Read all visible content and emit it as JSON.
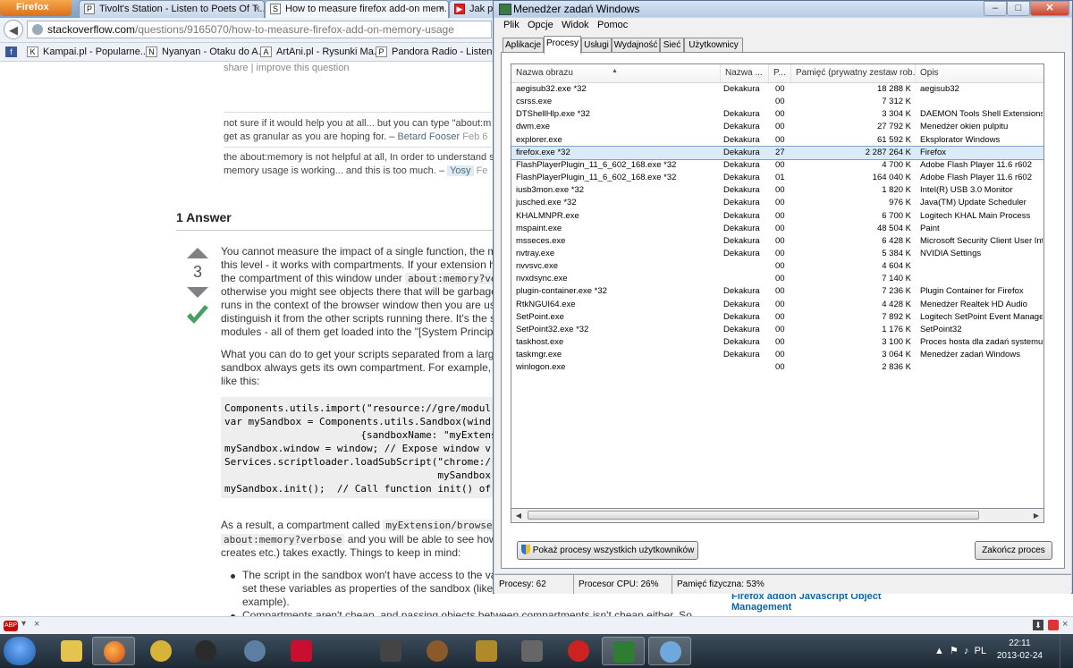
{
  "firefox": {
    "button_label": "Firefox",
    "tabs": [
      {
        "label": "Tivolt's Station - Listen to Poets Of T...",
        "favicon": "P"
      },
      {
        "label": "How to measure firefox add-on mem...",
        "favicon": "S"
      },
      {
        "label": "Jak po",
        "favicon": "▶"
      }
    ],
    "url_host": "stackoverflow.com",
    "url_path": "/questions/9165070/how-to-measure-firefox-add-on-memory-usage",
    "bookmarks": [
      {
        "label": "Kampai.pl - Popularne...",
        "icon": "K"
      },
      {
        "label": "Nyanyan - Otaku do A...",
        "icon": "N"
      },
      {
        "label": "ArtAni.pl - Rysunki Ma...",
        "icon": "A"
      },
      {
        "label": "Pandora Radio - Listen...",
        "icon": "P"
      }
    ],
    "addonbar_icon": "ABP"
  },
  "stackoverflow": {
    "question_links": {
      "share": "share",
      "sep": "|",
      "improve": "improve this question"
    },
    "comment1": {
      "line1": "not sure if it would help you at all... but you can type \"about:m",
      "line2": "get as granular as you are hoping for. – ",
      "user": "Betard Fooser",
      "date": "Feb 6"
    },
    "comment2": {
      "line1": "the about:memory is not helpful at all, In order to understand s",
      "line2": "memory usage is working... and this is too much. – ",
      "user": "Yosy",
      "date": "Fe"
    },
    "answer_header": "1 Answer",
    "vote_count": "3",
    "answer_lines": [
      "You cannot measure the impact of a single function, the m",
      "this level - it works with compartments. If your extension ha",
      "otherwise you might see objects there that will be garbage",
      "runs in the context of the browser window then you are usu",
      "distinguish it from the other scripts running there. It's the s",
      "modules - all of them get loaded into the \"[System Principa"
    ],
    "answer_line3_pre": "the compartment of this window under ",
    "answer_line3_code": "about:memory?ve",
    "para2_lines": [
      "What you can do to get your scripts separated from a larg",
      "sandbox always gets its own compartment. For example, in",
      "like this:"
    ],
    "code_lines": [
      "Components.utils.import(\"resource://gre/modul",
      "var mySandbox = Components.utils.Sandbox(wind",
      "                       {sandboxName: \"myExtension/",
      "mySandbox.window = window; // Expose window v",
      "Services.scriptloader.loadSubScript(\"chrome:/",
      "                                    mySandbox",
      "mySandbox.init();  // Call function init() of"
    ],
    "para3_pre": "As a result, a compartment called ",
    "para3_code1": "myExtension/browser",
    "para3_code2": "about:memory?verbose",
    "para3_mid": " and you will be able to see how",
    "para3_line3": "creates etc.) takes exactly. Things to keep in mind:",
    "bullet1_lines": [
      "The script in the sandbox won't have access to the va",
      "set these variables as properties of the sandbox (like",
      "example)."
    ],
    "bullet2": "Compartments aren't cheap, and passing objects between compartments isn't cheap either. So",
    "sidebar_link": [
      "Firefox addon Javascript Object",
      "Management"
    ]
  },
  "taskmgr": {
    "title": "Menedżer zadań Windows",
    "window_buttons": {
      "minimize": "–",
      "maximize": "□",
      "close": "✕"
    },
    "menu": [
      "Plik",
      "Opcje",
      "Widok",
      "Pomoc"
    ],
    "tabs": [
      "Aplikacje",
      "Procesy",
      "Usługi",
      "Wydajność",
      "Sieć",
      "Użytkownicy"
    ],
    "active_tab": "Procesy",
    "columns": [
      "Nazwa obrazu",
      "Nazwa ...",
      "P...",
      "Pamięć (prywatny zestaw rob...",
      "Opis"
    ],
    "processes": [
      {
        "name": "aegisub32.exe *32",
        "user": "Dekakura",
        "cpu": "00",
        "mem": "18 288 K",
        "desc": "aegisub32"
      },
      {
        "name": "csrss.exe",
        "user": "",
        "cpu": "00",
        "mem": "7 312 K",
        "desc": ""
      },
      {
        "name": "DTShellHlp.exe *32",
        "user": "Dekakura",
        "cpu": "00",
        "mem": "3 304 K",
        "desc": "DAEMON Tools Shell Extensions Hel"
      },
      {
        "name": "dwm.exe",
        "user": "Dekakura",
        "cpu": "00",
        "mem": "27 792 K",
        "desc": "Menedżer okien pulpitu"
      },
      {
        "name": "explorer.exe",
        "user": "Dekakura",
        "cpu": "00",
        "mem": "61 592 K",
        "desc": "Eksplorator Windows"
      },
      {
        "name": "firefox.exe *32",
        "user": "Dekakura",
        "cpu": "27",
        "mem": "2 287 264 K",
        "desc": "Firefox"
      },
      {
        "name": "FlashPlayerPlugin_11_6_602_168.exe *32",
        "user": "Dekakura",
        "cpu": "00",
        "mem": "4 700 K",
        "desc": "Adobe Flash Player 11.6 r602"
      },
      {
        "name": "FlashPlayerPlugin_11_6_602_168.exe *32",
        "user": "Dekakura",
        "cpu": "01",
        "mem": "164 040 K",
        "desc": "Adobe Flash Player 11.6 r602"
      },
      {
        "name": "iusb3mon.exe *32",
        "user": "Dekakura",
        "cpu": "00",
        "mem": "1 820 K",
        "desc": "Intel(R) USB 3.0 Monitor"
      },
      {
        "name": "jusched.exe *32",
        "user": "Dekakura",
        "cpu": "00",
        "mem": "976 K",
        "desc": "Java(TM) Update Scheduler"
      },
      {
        "name": "KHALMNPR.exe",
        "user": "Dekakura",
        "cpu": "00",
        "mem": "6 700 K",
        "desc": "Logitech KHAL Main Process"
      },
      {
        "name": "mspaint.exe",
        "user": "Dekakura",
        "cpu": "00",
        "mem": "48 504 K",
        "desc": "Paint"
      },
      {
        "name": "msseces.exe",
        "user": "Dekakura",
        "cpu": "00",
        "mem": "6 428 K",
        "desc": "Microsoft Security Client User Inter"
      },
      {
        "name": "nvtray.exe",
        "user": "Dekakura",
        "cpu": "00",
        "mem": "5 384 K",
        "desc": "NVIDIA Settings"
      },
      {
        "name": "nvvsvc.exe",
        "user": "",
        "cpu": "00",
        "mem": "4 604 K",
        "desc": ""
      },
      {
        "name": "nvxdsync.exe",
        "user": "",
        "cpu": "00",
        "mem": "7 140 K",
        "desc": ""
      },
      {
        "name": "plugin-container.exe *32",
        "user": "Dekakura",
        "cpu": "00",
        "mem": "7 236 K",
        "desc": "Plugin Container for Firefox"
      },
      {
        "name": "RtkNGUI64.exe",
        "user": "Dekakura",
        "cpu": "00",
        "mem": "4 428 K",
        "desc": "Menedżer Realtek HD Audio"
      },
      {
        "name": "SetPoint.exe",
        "user": "Dekakura",
        "cpu": "00",
        "mem": "7 892 K",
        "desc": "Logitech SetPoint Event Manager (U"
      },
      {
        "name": "SetPoint32.exe *32",
        "user": "Dekakura",
        "cpu": "00",
        "mem": "1 176 K",
        "desc": "SetPoint32"
      },
      {
        "name": "taskhost.exe",
        "user": "Dekakura",
        "cpu": "00",
        "mem": "3 100 K",
        "desc": "Proces hosta dla zadań systemu Wi"
      },
      {
        "name": "taskmgr.exe",
        "user": "Dekakura",
        "cpu": "00",
        "mem": "3 064 K",
        "desc": "Menedżer zadań Windows"
      },
      {
        "name": "winlogon.exe",
        "user": "",
        "cpu": "00",
        "mem": "2 836 K",
        "desc": ""
      }
    ],
    "selected_process": "firefox.exe *32",
    "show_all_button": "Pokaż procesy wszystkich użytkowników",
    "end_process_button": "Zakończ proces",
    "status": {
      "processes": "Procesy: 62",
      "cpu": "Procesor CPU: 26%",
      "memory": "Pamięć fizyczna: 53%"
    }
  },
  "taskbar": {
    "apps": [
      "file-explorer",
      "firefox",
      "key",
      "steam",
      "rainmeter",
      "zone",
      "fsw",
      "game",
      "bug",
      "shield-game",
      "media",
      "task-manager",
      "paint"
    ],
    "tray_text": "PL",
    "time": "22:11",
    "date": "2013-02-24"
  }
}
